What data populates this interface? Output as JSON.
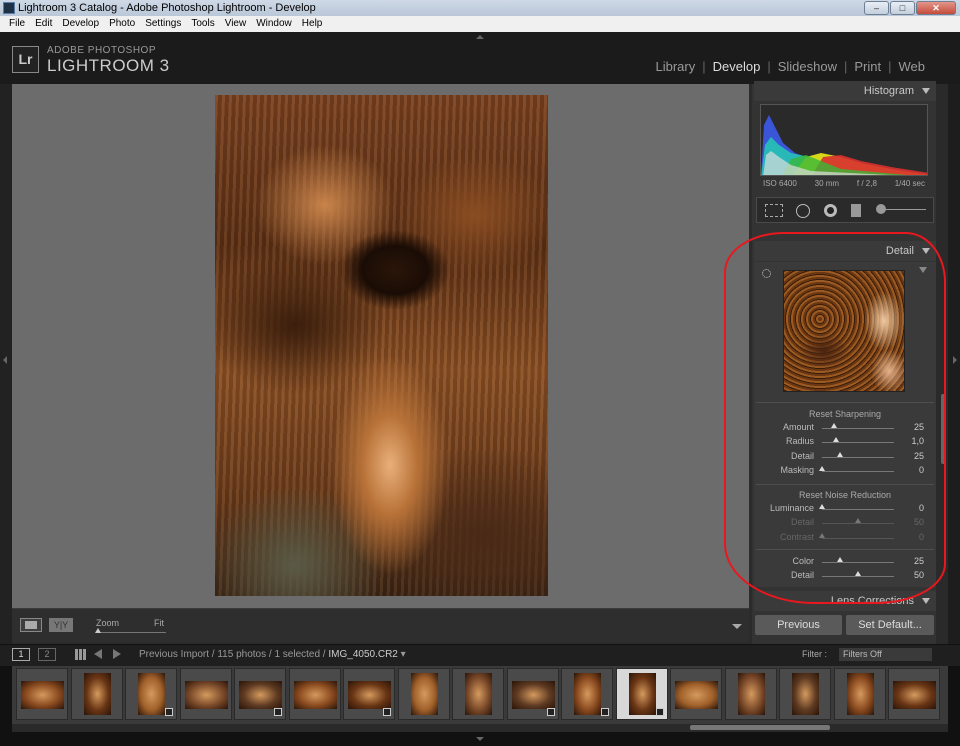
{
  "window": {
    "title": "Lightroom 3 Catalog - Adobe Photoshop Lightroom - Develop",
    "min": "–",
    "max": "□",
    "close": "✕"
  },
  "menu": [
    "File",
    "Edit",
    "Develop",
    "Photo",
    "Settings",
    "Tools",
    "View",
    "Window",
    "Help"
  ],
  "brand": {
    "logo": "Lr",
    "line1": "ADOBE PHOTOSHOP",
    "line2": "LIGHTROOM 3"
  },
  "modules": [
    {
      "label": "Library",
      "active": false
    },
    {
      "label": "Develop",
      "active": true
    },
    {
      "label": "Slideshow",
      "active": false
    },
    {
      "label": "Print",
      "active": false
    },
    {
      "label": "Web",
      "active": false
    }
  ],
  "toolbar": {
    "view_yy": "Y|Y",
    "zoom_label": "Zoom",
    "zoom_value": "Fit"
  },
  "histogram": {
    "title": "Histogram",
    "iso": "ISO 6400",
    "focal": "30 mm",
    "aperture": "f / 2,8",
    "shutter": "1/40 sec"
  },
  "detail": {
    "title": "Detail",
    "sharpening": {
      "title": "Reset Sharpening",
      "sliders": [
        {
          "label": "Amount",
          "value": "25",
          "pos": 0.17,
          "dim": false
        },
        {
          "label": "Radius",
          "value": "1,0",
          "pos": 0.2,
          "dim": false
        },
        {
          "label": "Detail",
          "value": "25",
          "pos": 0.25,
          "dim": false
        },
        {
          "label": "Masking",
          "value": "0",
          "pos": 0.0,
          "dim": false
        }
      ]
    },
    "noise": {
      "title": "Reset Noise Reduction",
      "sliders": [
        {
          "label": "Luminance",
          "value": "0",
          "pos": 0.0,
          "dim": false
        },
        {
          "label": "Detail",
          "value": "50",
          "pos": 0.5,
          "dim": true
        },
        {
          "label": "Contrast",
          "value": "0",
          "pos": 0.0,
          "dim": true
        },
        {
          "label": "Color",
          "value": "25",
          "pos": 0.25,
          "dim": false
        },
        {
          "label": "Detail",
          "value": "50",
          "pos": 0.5,
          "dim": false
        }
      ]
    }
  },
  "next_panel": {
    "title": "Lens Corrections"
  },
  "buttons": {
    "previous": "Previous",
    "set_default": "Set Default..."
  },
  "filmstrip": {
    "page1": "1",
    "page2": "2",
    "source": "Previous Import / 115 photos / 1 selected /",
    "filename": "IMG_4050.CR2",
    "filter_label": "Filter :",
    "filter_value": "Filters Off"
  },
  "thumbnails": [
    {
      "orient": "h",
      "badge": false,
      "selected": false
    },
    {
      "orient": "v",
      "badge": false,
      "selected": false
    },
    {
      "orient": "v",
      "badge": true,
      "selected": false
    },
    {
      "orient": "h",
      "badge": false,
      "selected": false
    },
    {
      "orient": "h",
      "badge": true,
      "selected": false
    },
    {
      "orient": "h",
      "badge": false,
      "selected": false
    },
    {
      "orient": "h",
      "badge": true,
      "selected": false
    },
    {
      "orient": "v",
      "badge": false,
      "selected": false
    },
    {
      "orient": "v",
      "badge": false,
      "selected": false
    },
    {
      "orient": "h",
      "badge": true,
      "selected": false
    },
    {
      "orient": "v",
      "badge": true,
      "selected": false
    },
    {
      "orient": "v",
      "badge": true,
      "selected": true
    },
    {
      "orient": "h",
      "badge": false,
      "selected": false
    },
    {
      "orient": "v",
      "badge": false,
      "selected": false
    },
    {
      "orient": "v",
      "badge": false,
      "selected": false
    },
    {
      "orient": "v",
      "badge": false,
      "selected": false
    },
    {
      "orient": "h",
      "badge": false,
      "selected": false
    }
  ],
  "colors": {
    "accent_annotation": "#e8181e",
    "panel_bg": "#333333",
    "canvas_bg": "#6c6c6c"
  }
}
